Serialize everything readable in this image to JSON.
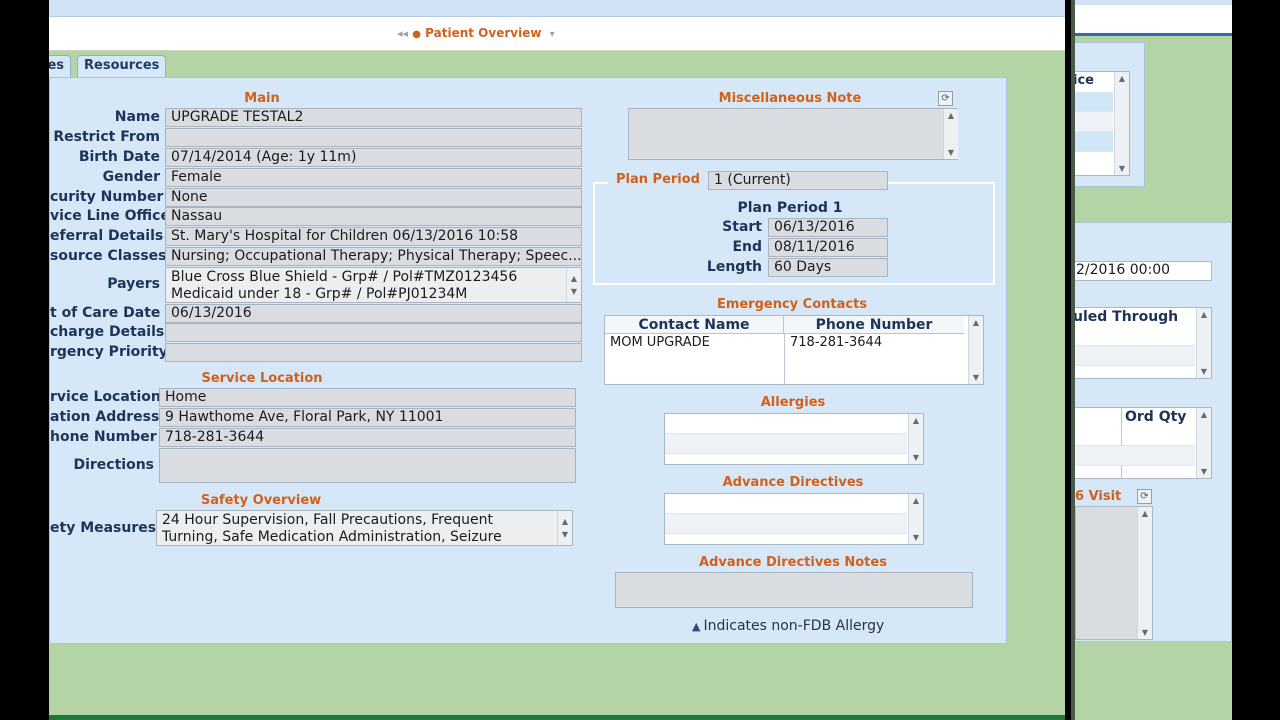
{
  "window": {
    "title": "Patient Overview",
    "nav_prev": "◂◂",
    "chevron": "▾"
  },
  "tabs": [
    {
      "label": "es"
    },
    {
      "label": "Resources"
    }
  ],
  "main": {
    "title": "Main",
    "fields": [
      {
        "label": "Name",
        "value": "UPGRADE TESTAL2"
      },
      {
        "label": "Restrict From",
        "value": ""
      },
      {
        "label": "Birth Date",
        "value": "07/14/2014 (Age: 1y 11m)"
      },
      {
        "label": "Gender",
        "value": "Female"
      },
      {
        "label": "curity Number",
        "value": "None"
      },
      {
        "label": "vice Line Office",
        "value": "Nassau"
      },
      {
        "label": "eferral Details",
        "value": "St. Mary's Hospital for Children   06/13/2016 10:58"
      },
      {
        "label": "source Classes",
        "value": "Nursing; Occupational Therapy; Physical Therapy; Speec..."
      },
      {
        "label": "Payers",
        "value_lines": [
          "Blue Cross Blue Shield - Grp# / Pol#TMZ0123456",
          "Medicaid under 18 - Grp# / Pol#PJ01234M"
        ]
      },
      {
        "label": "t of Care Date",
        "value": "06/13/2016"
      },
      {
        "label": "charge Details",
        "value": ""
      },
      {
        "label": "rgency Priority",
        "value": ""
      }
    ]
  },
  "service_location": {
    "title": "Service Location",
    "fields": [
      {
        "label": "rvice Location",
        "value": "Home"
      },
      {
        "label": "ation Address",
        "value": "9 Hawthome Ave, Floral Park, NY 11001"
      },
      {
        "label": "hone Number",
        "value": "718-281-3644"
      },
      {
        "label": "Directions",
        "value": ""
      }
    ]
  },
  "safety": {
    "title": "Safety Overview",
    "label": "ety Measures",
    "value_lines": [
      "24 Hour Supervision, Fall Precautions, Frequent",
      "Turning, Safe Medication Administration, Seizure"
    ]
  },
  "misc_note": {
    "title": "Miscellaneous Note",
    "value": ""
  },
  "plan_period": {
    "label": "Plan Period",
    "value": "1 (Current)",
    "sub_title": "Plan Period 1",
    "rows": [
      {
        "label": "Start",
        "value": "06/13/2016"
      },
      {
        "label": "End",
        "value": "08/11/2016"
      },
      {
        "label": "Length",
        "value": "60 Days"
      }
    ]
  },
  "emergency_contacts": {
    "title": "Emergency Contacts",
    "columns": [
      "Contact Name",
      "Phone Number"
    ],
    "rows": [
      [
        "MOM UPGRADE",
        "718-281-3644"
      ]
    ]
  },
  "allergies": {
    "title": "Allergies"
  },
  "advance_directives": {
    "title": "Advance Directives"
  },
  "advance_directives_notes": {
    "title": "Advance Directives Notes",
    "value": ""
  },
  "allergy_note": "Indicates non-FDB Allergy",
  "right_window": {
    "col1": "ice",
    "date_value": "2/2016 00:00",
    "scheduled_through": "uled Through",
    "ord_qty": "Ord Qty",
    "visit": "6 Visit"
  },
  "colors": {
    "section_title": "#d2601b",
    "label": "#1e3358",
    "panel_bg": "#d6e8f7",
    "window_bg": "#b4d4a6"
  }
}
